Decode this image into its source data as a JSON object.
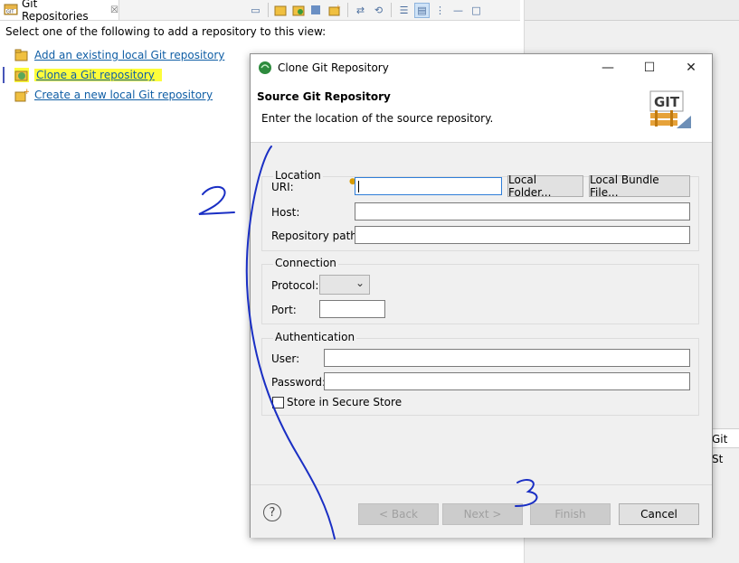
{
  "view": {
    "tab_title": "Git Repositories",
    "tab_close_glyph": "☒",
    "toolbar_icons": [
      "collapse-all-icon",
      "add-repo-icon",
      "clone-repo-icon",
      "import-icon",
      "create-repo-icon",
      "link-editor-icon",
      "refresh-icon",
      "hierarchical-icon",
      "view-menu-icon",
      "minimize-icon",
      "maximize-icon"
    ],
    "prompt": "Select one of the following to add a repository to this view:",
    "links": [
      {
        "label": "Add an existing local Git repository",
        "icon": "folder-icon"
      },
      {
        "label": "Clone a Git repository",
        "icon": "clone-icon",
        "highlighted": true
      },
      {
        "label": "Create a new local Git repository",
        "icon": "new-repo-icon"
      }
    ],
    "right_tab_label": "Git St"
  },
  "dialog": {
    "title": "Clone Git Repository",
    "header_title": "Source Git Repository",
    "header_description": "Enter the location of the source repository.",
    "logo_text": "GIT",
    "location": {
      "group_label": "Location",
      "uri_label": "URI:",
      "uri_value": "",
      "local_folder_button": "Local Folder...",
      "local_bundle_button": "Local Bundle File...",
      "host_label": "Host:",
      "host_value": "",
      "repo_path_label": "Repository path:",
      "repo_path_value": ""
    },
    "connection": {
      "group_label": "Connection",
      "protocol_label": "Protocol:",
      "protocol_value": "",
      "port_label": "Port:",
      "port_value": ""
    },
    "authentication": {
      "group_label": "Authentication",
      "user_label": "User:",
      "user_value": "",
      "password_label": "Password:",
      "password_value": "",
      "store_label": "Store in Secure Store",
      "store_checked": false
    },
    "buttons": {
      "back": "< Back",
      "next": "Next >",
      "finish": "Finish",
      "cancel": "Cancel",
      "help": "?"
    }
  },
  "annotations": {
    "step2": "2",
    "step3": "3",
    "ink_color": "#1a2fc4",
    "highlight_color": "#fdfd3a"
  }
}
